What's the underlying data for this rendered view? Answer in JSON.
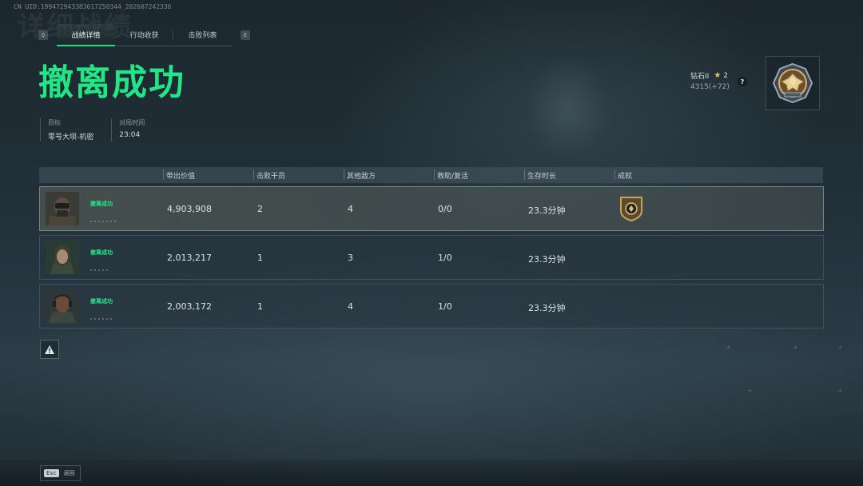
{
  "uid_text": "CN UID:1994729433836172503​44_202607242336",
  "watermark": "详细战绩",
  "tabs": {
    "prev_key": "Q",
    "next_key": "E",
    "items": [
      {
        "label": "战绩详情",
        "active": true
      },
      {
        "label": "行动收获",
        "active": false
      },
      {
        "label": "击败列表",
        "active": false
      }
    ]
  },
  "title": "撤离成功",
  "info": {
    "target_label": "目标",
    "target_value": "零号大坝-机密",
    "duration_label": "对局时间",
    "duration_value": "23:04"
  },
  "rank": {
    "tier": "钻石II",
    "stars": "2",
    "points": "4315(+72)",
    "help": "?",
    "emblem_icon": "eagle-rank-emblem"
  },
  "table": {
    "headers": [
      "带出价值",
      "击败干员",
      "其他敌方",
      "救助/复活",
      "生存时长",
      "成就"
    ],
    "rows": [
      {
        "status": "撤离成功",
        "value": "4,903,908",
        "operators": "2",
        "others": "4",
        "assist": "0/0",
        "survival": "23.3分钟",
        "achievement": true,
        "highlight": true
      },
      {
        "status": "撤离成功",
        "value": "2,013,217",
        "operators": "1",
        "others": "3",
        "assist": "1/0",
        "survival": "23.3分钟",
        "achievement": false,
        "highlight": false
      },
      {
        "status": "撤离成功",
        "value": "2,003,172",
        "operators": "1",
        "others": "4",
        "assist": "1/0",
        "survival": "23.3分钟",
        "achievement": false,
        "highlight": false
      }
    ]
  },
  "footer": {
    "esc_key": "Esc",
    "back_label": "返回"
  },
  "colors": {
    "accent_green": "#22e585",
    "star_gold": "#e8c766"
  }
}
